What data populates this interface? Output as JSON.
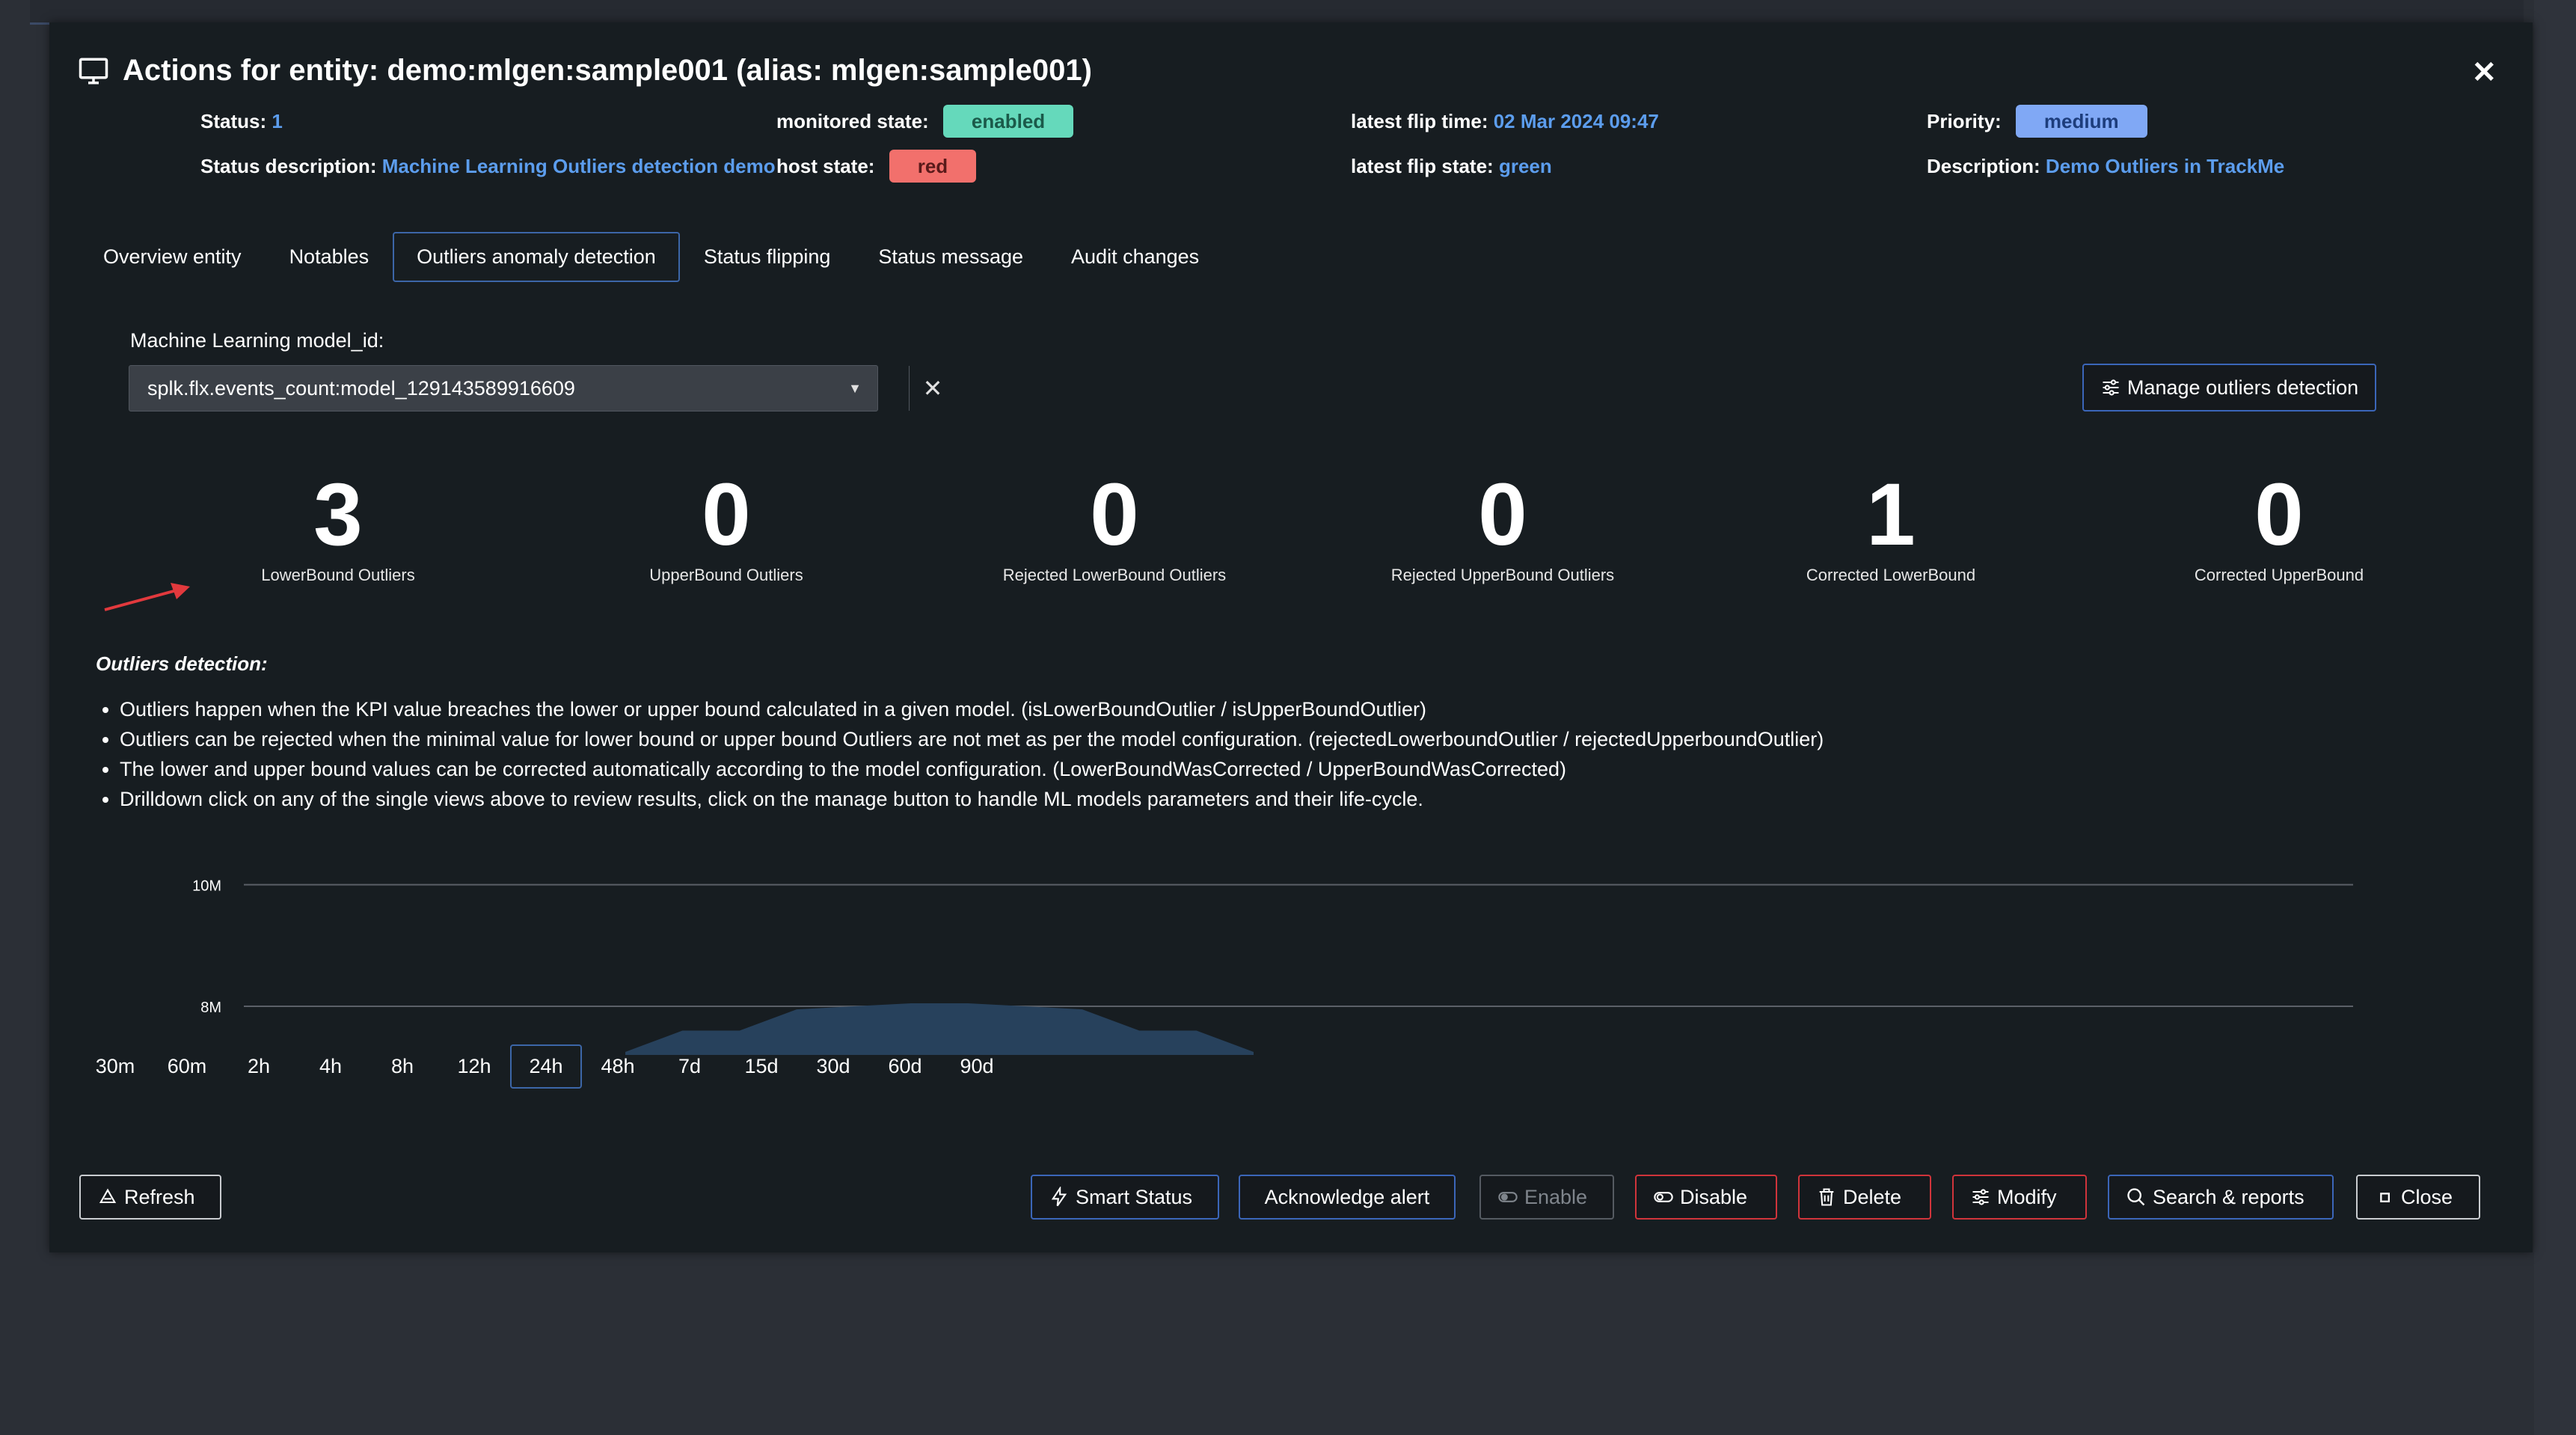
{
  "modal": {
    "title": "Actions for entity: demo:mlgen:sample001 (alias: mlgen:sample001)",
    "close_symbol": "✕"
  },
  "meta": {
    "status_label": "Status:",
    "status_value": "1",
    "status_desc_label": "Status description:",
    "status_desc_value": "Machine Learning Outliers detection demo",
    "monitored_label": "monitored state:",
    "monitored_value": "enabled",
    "host_label": "host state:",
    "host_value": "red",
    "flip_time_label": "latest flip time:",
    "flip_time_value": "02 Mar 2024 09:47",
    "flip_state_label": "latest flip state:",
    "flip_state_value": "green",
    "priority_label": "Priority:",
    "priority_value": "medium",
    "description_label": "Description:",
    "description_value": "Demo Outliers in TrackMe"
  },
  "tabs": [
    {
      "label": "Overview entity",
      "active": false
    },
    {
      "label": "Notables",
      "active": false
    },
    {
      "label": "Outliers anomaly detection",
      "active": true
    },
    {
      "label": "Status flipping",
      "active": false
    },
    {
      "label": "Status message",
      "active": false
    },
    {
      "label": "Audit changes",
      "active": false
    }
  ],
  "ml": {
    "label": "Machine Learning model_id:",
    "selected": "splk.flx.events_count:model_129143589916609",
    "manage_label": "Manage outliers detection"
  },
  "stats": [
    {
      "value": "3",
      "label": "LowerBound Outliers"
    },
    {
      "value": "0",
      "label": "UpperBound Outliers"
    },
    {
      "value": "0",
      "label": "Rejected LowerBound Outliers"
    },
    {
      "value": "0",
      "label": "Rejected UpperBound Outliers"
    },
    {
      "value": "1",
      "label": "Corrected LowerBound"
    },
    {
      "value": "0",
      "label": "Corrected UpperBound"
    }
  ],
  "outliers_info": {
    "title": "Outliers detection:",
    "items": [
      "Outliers happen when the KPI value breaches the lower or upper bound calculated in a given model. (isLowerBoundOutlier / isUpperBoundOutlier)",
      "Outliers can be rejected when the minimal value for lower bound or upper bound Outliers are not met as per the model configuration. (rejectedLowerboundOutlier / rejectedUpperboundOutlier)",
      "The lower and upper bound values can be corrected automatically according to the model configuration. (LowerBoundWasCorrected / UpperBoundWasCorrected)",
      "Drilldown click on any of the single views above to review results, click on the manage button to handle ML models parameters and their life-cycle."
    ]
  },
  "chart_data": {
    "type": "area",
    "title": "",
    "xlabel": "",
    "ylabel": "",
    "y_ticks": [
      "10M",
      "8M"
    ],
    "ylim": [
      7200000,
      10400000
    ],
    "x": [
      0,
      1,
      2,
      3,
      4,
      5,
      6,
      7,
      8,
      9,
      10,
      11
    ],
    "series": [
      {
        "values": [
          7250000.0,
          7600000.0,
          7600000.0,
          7950000.0,
          8000000.0,
          8050000.0,
          8050000.0,
          8000000.0,
          7950000.0,
          7600000.0,
          7600000.0,
          7250000.0
        ]
      }
    ],
    "color": "#27415c"
  },
  "time_ranges": [
    {
      "label": "30m",
      "active": false
    },
    {
      "label": "60m",
      "active": false
    },
    {
      "label": "2h",
      "active": false
    },
    {
      "label": "4h",
      "active": false
    },
    {
      "label": "8h",
      "active": false
    },
    {
      "label": "12h",
      "active": false
    },
    {
      "label": "24h",
      "active": true
    },
    {
      "label": "48h",
      "active": false
    },
    {
      "label": "7d",
      "active": false
    },
    {
      "label": "15d",
      "active": false
    },
    {
      "label": "30d",
      "active": false
    },
    {
      "label": "60d",
      "active": false
    },
    {
      "label": "90d",
      "active": false
    }
  ],
  "footer": {
    "refresh": "Refresh",
    "smart_status": "Smart Status",
    "acknowledge": "Acknowledge alert",
    "enable": "Enable",
    "disable": "Disable",
    "delete": "Delete",
    "modify": "Modify",
    "search_reports": "Search & reports",
    "close": "Close"
  }
}
